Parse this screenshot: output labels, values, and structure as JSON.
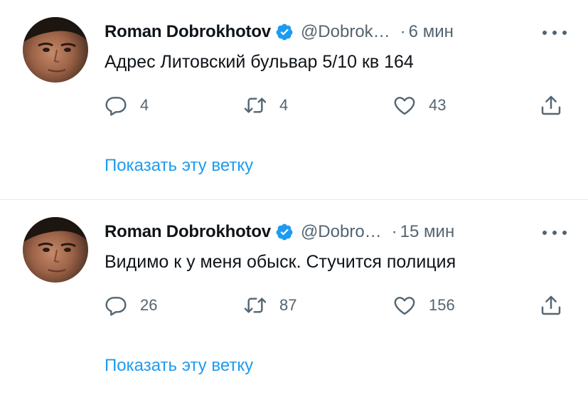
{
  "tweets": [
    {
      "author_name": "Roman Dobrokhotov",
      "handle": "@Dobrok…",
      "time": "6 мин",
      "text": "Адрес Литовский бульвар 5/10 кв 164",
      "replies": "4",
      "retweets": "4",
      "likes": "43",
      "show_thread": "Показать эту ветку"
    },
    {
      "author_name": "Roman Dobrokhotov",
      "handle": "@Dobro…",
      "time": "15 мин",
      "text": "Видимо к у меня обыск. Стучится полиция",
      "replies": "26",
      "retweets": "87",
      "likes": "156",
      "show_thread": "Показать эту ветку"
    }
  ],
  "separator": "·",
  "icons": {
    "verified": "verified-badge-icon",
    "more": "more-options-icon",
    "reply": "reply-icon",
    "retweet": "retweet-icon",
    "like": "heart-icon",
    "share": "share-icon"
  },
  "colors": {
    "accent": "#1d9bf0",
    "secondary_text": "#536471",
    "primary_text": "#0f1419",
    "divider": "#e7e9ea"
  }
}
